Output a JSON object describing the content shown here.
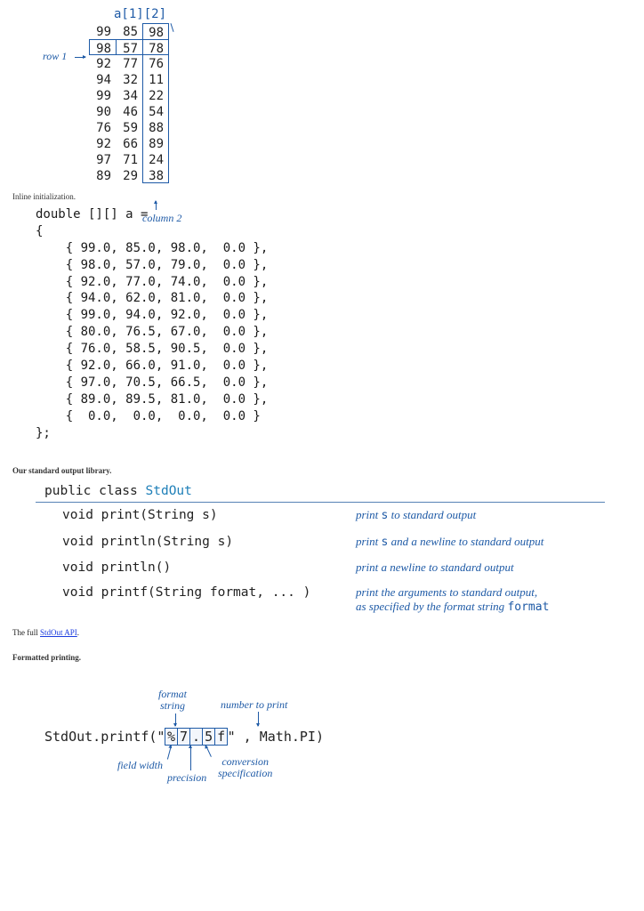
{
  "array_diag": {
    "index_label": "a[1][2]",
    "row_label": "row 1",
    "col_label": "column 2",
    "grid": [
      [
        99,
        85,
        98
      ],
      [
        98,
        57,
        78
      ],
      [
        92,
        77,
        76
      ],
      [
        94,
        32,
        11
      ],
      [
        99,
        34,
        22
      ],
      [
        90,
        46,
        54
      ],
      [
        76,
        59,
        88
      ],
      [
        92,
        66,
        89
      ],
      [
        97,
        71,
        24
      ],
      [
        89,
        29,
        38
      ]
    ]
  },
  "labels": {
    "inline_init": "Inline initialization.",
    "stdout_lib": "Our standard output library.",
    "full_api_pre": "The full ",
    "full_api_link": "StdOut API",
    "full_api_post": ".",
    "fmt_print": "Formatted printing."
  },
  "code_init": "double [][] a =\n{\n    { 99.0, 85.0, 98.0,  0.0 },\n    { 98.0, 57.0, 79.0,  0.0 },\n    { 92.0, 77.0, 74.0,  0.0 },\n    { 94.0, 62.0, 81.0,  0.0 },\n    { 99.0, 94.0, 92.0,  0.0 },\n    { 80.0, 76.5, 67.0,  0.0 },\n    { 76.0, 58.5, 90.5,  0.0 },\n    { 92.0, 66.0, 91.0,  0.0 },\n    { 97.0, 70.5, 66.5,  0.0 },\n    { 89.0, 89.5, 81.0,  0.0 },\n    {  0.0,  0.0,  0.0,  0.0 }\n};",
  "api": {
    "head_pre": "public class ",
    "head_cls": "StdOut",
    "rows": [
      {
        "sig": "void  print(String s)",
        "desc_pre": "print ",
        "var": "s",
        "desc_post": " to standard output"
      },
      {
        "sig": "void  println(String s)",
        "desc_pre": "print ",
        "var": "s",
        "desc_post": " and a newline to standard output"
      },
      {
        "sig": "void  println()",
        "desc_pre": "print a newline to standard output",
        "var": "",
        "desc_post": ""
      },
      {
        "sig": "void  printf(String format, ... )",
        "desc_pre": "print the arguments to standard output,\nas specified by the format string ",
        "var": "format",
        "desc_post": ""
      }
    ]
  },
  "fmt": {
    "code_pre": "StdOut.printf(\"",
    "c0": "%",
    "c1": "7",
    "c2": ".",
    "c3": "5",
    "c4": "f",
    "code_post": "\" , Math.PI)",
    "ann_format": "format\nstring",
    "ann_number": "number to print",
    "ann_field": "field width",
    "ann_precision": "precision",
    "ann_conv": "conversion\nspecification"
  }
}
